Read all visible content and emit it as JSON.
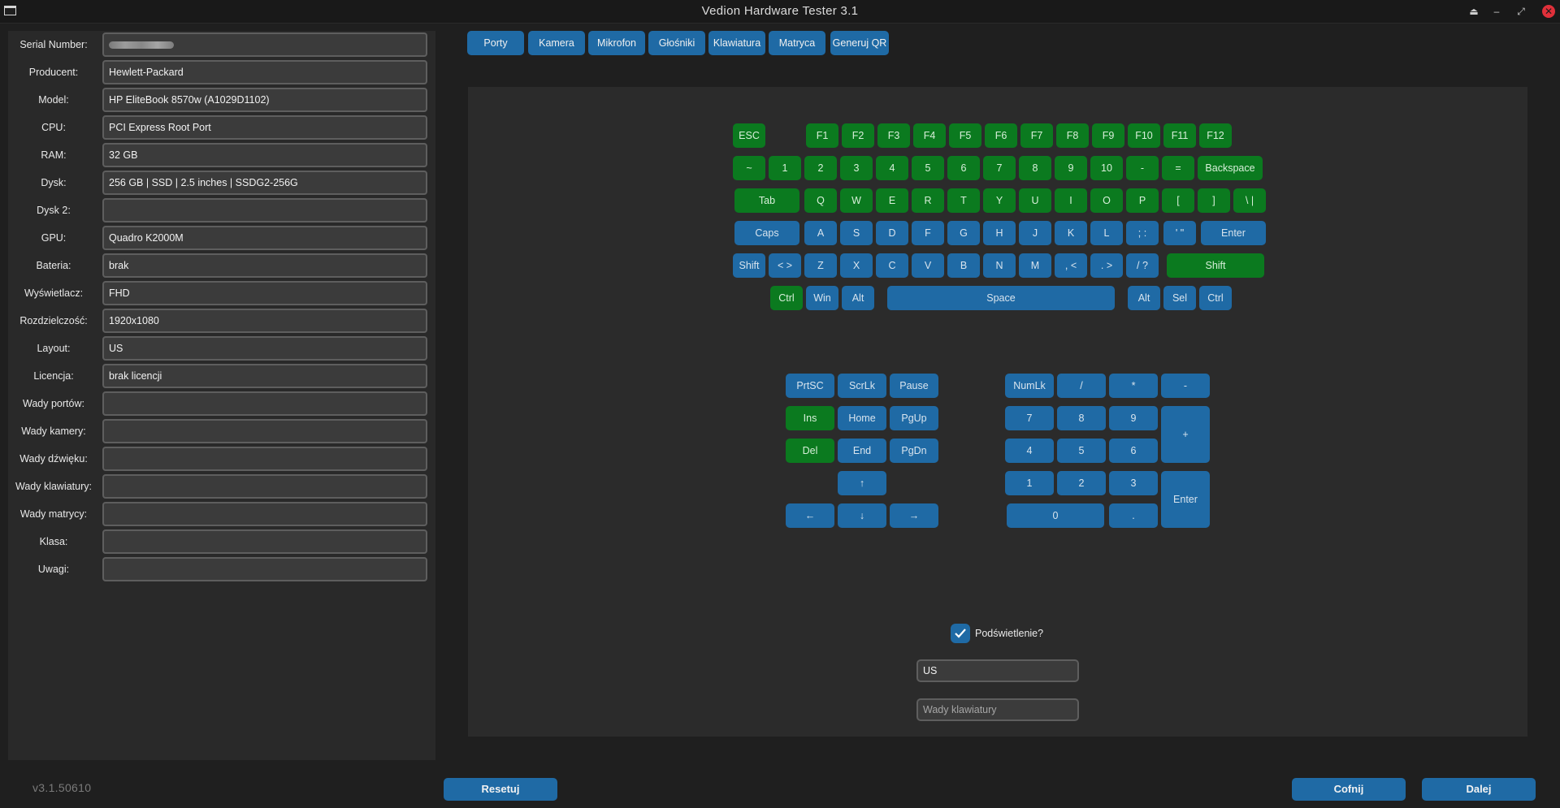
{
  "window": {
    "title": "Vedion Hardware Tester 3.1"
  },
  "fields": [
    {
      "label": "Serial Number:",
      "value": ""
    },
    {
      "label": "Producent:",
      "value": "Hewlett-Packard"
    },
    {
      "label": "Model:",
      "value": "HP EliteBook 8570w (A1029D1102)"
    },
    {
      "label": "CPU:",
      "value": "PCI Express Root Port"
    },
    {
      "label": "RAM:",
      "value": "32 GB"
    },
    {
      "label": "Dysk:",
      "value": "256 GB | SSD | 2.5 inches | SSDG2-256G"
    },
    {
      "label": "Dysk 2:",
      "value": ""
    },
    {
      "label": "GPU:",
      "value": "Quadro K2000M"
    },
    {
      "label": "Bateria:",
      "value": "brak"
    },
    {
      "label": "Wyświetlacz:",
      "value": "FHD"
    },
    {
      "label": "Rozdzielczość:",
      "value": "1920x1080"
    },
    {
      "label": "Layout:",
      "value": "US"
    },
    {
      "label": "Licencja:",
      "value": "brak licencji"
    },
    {
      "label": "Wady portów:",
      "value": ""
    },
    {
      "label": "Wady kamery:",
      "value": ""
    },
    {
      "label": "Wady dźwięku:",
      "value": ""
    },
    {
      "label": "Wady klawiatury:",
      "value": ""
    },
    {
      "label": "Wady matrycy:",
      "value": ""
    },
    {
      "label": "Klasa:",
      "value": ""
    },
    {
      "label": "Uwagi:",
      "value": ""
    }
  ],
  "tabs": [
    "Porty",
    "Kamera",
    "Mikrofon",
    "Głośniki",
    "Klawiatura",
    "Matryca",
    "Generuj QR"
  ],
  "keyboard": {
    "main_rows": [
      [
        {
          "l": "ESC",
          "g": true
        },
        {
          "l": "F1",
          "g": true
        },
        {
          "l": "F2",
          "g": true
        },
        {
          "l": "F3",
          "g": true
        },
        {
          "l": "F4",
          "g": true
        },
        {
          "l": "F5",
          "g": true
        },
        {
          "l": "F6",
          "g": true
        },
        {
          "l": "F7",
          "g": true
        },
        {
          "l": "F8",
          "g": true
        },
        {
          "l": "F9",
          "g": true
        },
        {
          "l": "F10",
          "g": true
        },
        {
          "l": "F11",
          "g": true
        },
        {
          "l": "F12",
          "g": true
        }
      ],
      [
        {
          "l": "~",
          "g": true
        },
        {
          "l": "1",
          "g": true
        },
        {
          "l": "2",
          "g": true
        },
        {
          "l": "3",
          "g": true
        },
        {
          "l": "4",
          "g": true
        },
        {
          "l": "5",
          "g": true
        },
        {
          "l": "6",
          "g": true
        },
        {
          "l": "7",
          "g": true
        },
        {
          "l": "8",
          "g": true
        },
        {
          "l": "9",
          "g": true
        },
        {
          "l": "10",
          "g": true
        },
        {
          "l": "-",
          "g": true
        },
        {
          "l": "=",
          "g": true
        },
        {
          "l": "Backspace",
          "g": true
        }
      ],
      [
        {
          "l": "Tab",
          "g": true
        },
        {
          "l": "Q",
          "g": true
        },
        {
          "l": "W",
          "g": true
        },
        {
          "l": "E",
          "g": true
        },
        {
          "l": "R",
          "g": true
        },
        {
          "l": "T",
          "g": true
        },
        {
          "l": "Y",
          "g": true
        },
        {
          "l": "U",
          "g": true
        },
        {
          "l": "I",
          "g": true
        },
        {
          "l": "O",
          "g": true
        },
        {
          "l": "P",
          "g": true
        },
        {
          "l": "[",
          "g": true
        },
        {
          "l": "]",
          "g": true
        },
        {
          "l": "\\ |",
          "g": true
        }
      ],
      [
        {
          "l": "Caps",
          "g": false
        },
        {
          "l": "A",
          "g": false
        },
        {
          "l": "S",
          "g": false
        },
        {
          "l": "D",
          "g": false
        },
        {
          "l": "F",
          "g": false
        },
        {
          "l": "G",
          "g": false
        },
        {
          "l": "H",
          "g": false
        },
        {
          "l": "J",
          "g": false
        },
        {
          "l": "K",
          "g": false
        },
        {
          "l": "L",
          "g": false
        },
        {
          "l": "; :",
          "g": false
        },
        {
          "l": "' \"",
          "g": false
        },
        {
          "l": "Enter",
          "g": false
        }
      ],
      [
        {
          "l": "Shift",
          "g": false
        },
        {
          "l": "< >",
          "g": false
        },
        {
          "l": "Z",
          "g": false
        },
        {
          "l": "X",
          "g": false
        },
        {
          "l": "C",
          "g": false
        },
        {
          "l": "V",
          "g": false
        },
        {
          "l": "B",
          "g": false
        },
        {
          "l": "N",
          "g": false
        },
        {
          "l": "M",
          "g": false
        },
        {
          "l": ", <",
          "g": false
        },
        {
          "l": ". >",
          "g": false
        },
        {
          "l": "/ ?",
          "g": false
        },
        {
          "l": "Shift",
          "g": true
        }
      ],
      [
        {
          "l": "Ctrl",
          "g": true
        },
        {
          "l": "Win",
          "g": false
        },
        {
          "l": "Alt",
          "g": false
        },
        {
          "l": "Space",
          "g": false
        },
        {
          "l": "Alt",
          "g": false
        },
        {
          "l": "Sel",
          "g": false
        },
        {
          "l": "Ctrl",
          "g": false
        }
      ]
    ],
    "nav_keys": [
      {
        "l": "PrtSC",
        "g": false
      },
      {
        "l": "ScrLk",
        "g": false
      },
      {
        "l": "Pause",
        "g": false
      },
      {
        "l": "Ins",
        "g": true
      },
      {
        "l": "Home",
        "g": false
      },
      {
        "l": "PgUp",
        "g": false
      },
      {
        "l": "Del",
        "g": true
      },
      {
        "l": "End",
        "g": false
      },
      {
        "l": "PgDn",
        "g": false
      },
      {
        "l": "↑",
        "g": false
      },
      {
        "l": "←",
        "g": false
      },
      {
        "l": "↓",
        "g": false
      },
      {
        "l": "→",
        "g": false
      }
    ],
    "numpad_keys": [
      {
        "l": "NumLk",
        "g": false
      },
      {
        "l": "/",
        "g": false
      },
      {
        "l": "*",
        "g": false
      },
      {
        "l": "-",
        "g": false
      },
      {
        "l": "7",
        "g": false
      },
      {
        "l": "8",
        "g": false
      },
      {
        "l": "9",
        "g": false
      },
      {
        "l": "+",
        "g": false
      },
      {
        "l": "4",
        "g": false
      },
      {
        "l": "5",
        "g": false
      },
      {
        "l": "6",
        "g": false
      },
      {
        "l": "1",
        "g": false
      },
      {
        "l": "2",
        "g": false
      },
      {
        "l": "3",
        "g": false
      },
      {
        "l": "Enter",
        "g": false
      },
      {
        "l": "0",
        "g": false
      },
      {
        "l": ".",
        "g": false
      }
    ]
  },
  "backlight": {
    "label": "Podświetlenie?",
    "checked": true
  },
  "layout_field": {
    "value": "US"
  },
  "defects_field": {
    "placeholder": "Wady klawiatury"
  },
  "version": "v3.1.50610",
  "buttons": {
    "reset": "Resetuj",
    "back": "Cofnij",
    "next": "Dalej"
  },
  "colors": {
    "accent": "#1f6aa5",
    "tested": "#0b7a1f",
    "close": "#e0303a"
  }
}
